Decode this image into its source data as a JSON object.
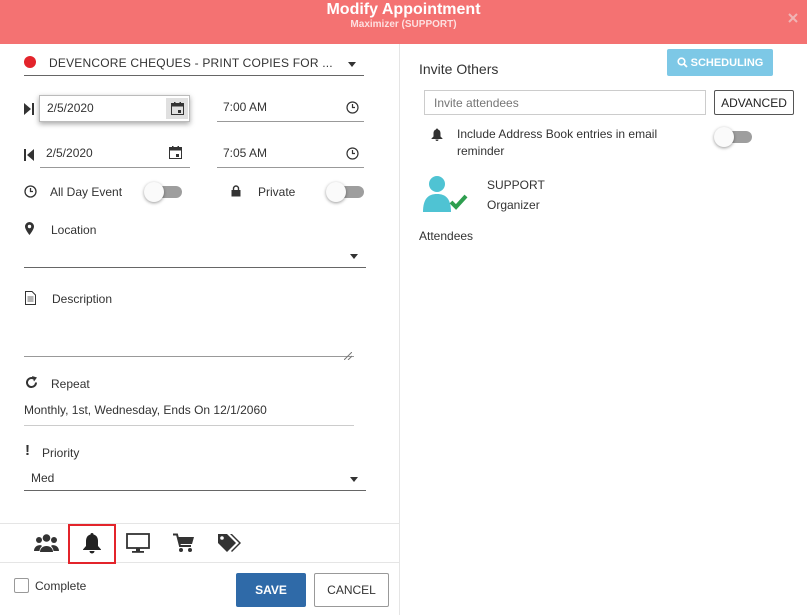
{
  "header": {
    "title": "Modify Appointment",
    "subtitle": "Maximizer (SUPPORT)",
    "close_icon": "close-icon"
  },
  "appointment": {
    "subject": "DEVENCORE CHEQUES - PRINT COPIES FOR ...",
    "subject_color": "#e3242b",
    "start_date": "2/5/2020",
    "start_time": "7:00 AM",
    "end_date": "2/5/2020",
    "end_time": "7:05 AM",
    "all_day_label": "All Day Event",
    "all_day_on": false,
    "private_label": "Private",
    "private_on": false,
    "location_label": "Location",
    "location_value": "",
    "description_label": "Description",
    "description_value": "",
    "repeat_label": "Repeat",
    "repeat_value": "Monthly, 1st, Wednesday, Ends On 12/1/2060",
    "priority_label": "Priority",
    "priority_value": "Med"
  },
  "tabs": [
    {
      "icon": "users-icon",
      "selected": false
    },
    {
      "icon": "bell-icon",
      "selected": true
    },
    {
      "icon": "monitor-icon",
      "selected": false
    },
    {
      "icon": "cart-icon",
      "selected": false
    },
    {
      "icon": "tags-icon",
      "selected": false
    }
  ],
  "footer": {
    "complete_label": "Complete",
    "complete_checked": false,
    "save_label": "SAVE",
    "cancel_label": "CANCEL"
  },
  "invite": {
    "title": "Invite Others",
    "scheduling_label": "SCHEDULING",
    "attendees_placeholder": "Invite attendees",
    "advanced_label": "ADVANCED",
    "include_address_book_label": "Include Address Book entries in email reminder",
    "include_address_book_on": false,
    "organizer_name": "SUPPORT",
    "organizer_role": "Organizer",
    "attendees_label": "Attendees"
  },
  "colors": {
    "header_bg": "#f47272",
    "save_bg": "#2f6aa8",
    "scheduling_bg": "#7dc8e6",
    "organizer_avatar": "#4fc3d3",
    "organizer_check": "#2e9e4f"
  }
}
